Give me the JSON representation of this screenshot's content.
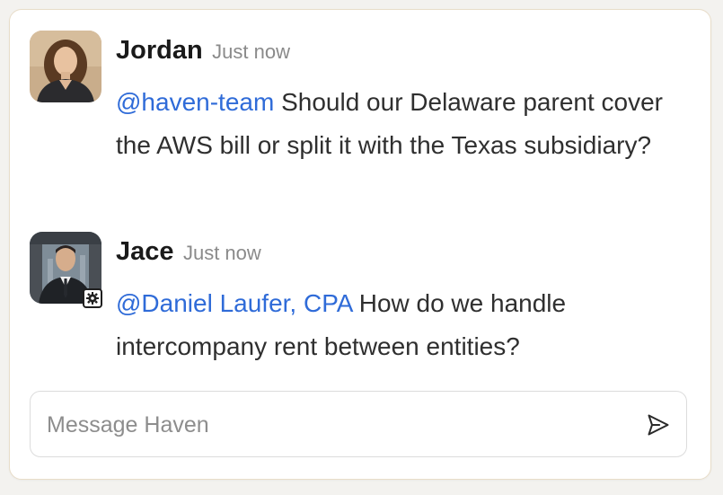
{
  "messages": [
    {
      "author": "Jordan",
      "time": "Just now",
      "mention": "@haven-team",
      "text": "Should our Delaware parent cover the AWS bill or split it with the Texas subsidiary?",
      "avatar_icon": "person-photo-icon"
    },
    {
      "author": "Jace",
      "time": "Just now",
      "mention": "@Daniel Laufer, CPA",
      "text": "How do we handle intercompany rent between entities?",
      "avatar_icon": "person-photo-icon",
      "badge_icon": "gear-icon"
    }
  ],
  "composer": {
    "placeholder": "Message Haven",
    "send_icon": "send-icon"
  },
  "colors": {
    "mention": "#2f6bd8",
    "card_border": "#e8ddc9",
    "name": "#1a1a1a",
    "timestamp": "#8a8a8a"
  }
}
